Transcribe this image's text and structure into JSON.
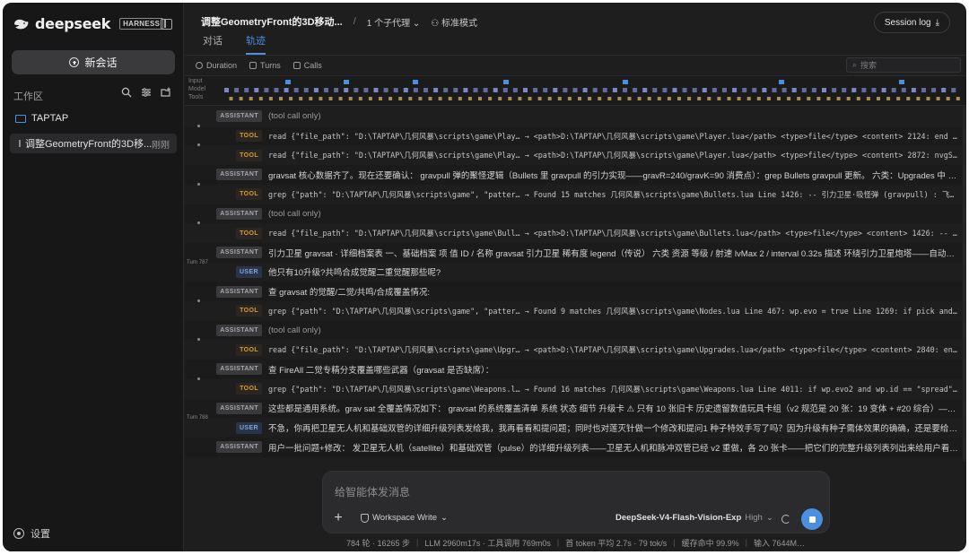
{
  "sidebar": {
    "brand": "deepseek",
    "badge": "HARNESS",
    "new_chat": "新会话",
    "workspace_label": "工作区",
    "folder": "TAPTAP",
    "session": {
      "title": "调整GeometryFront的3D移...",
      "time": "刚刚"
    },
    "settings": "设置"
  },
  "header": {
    "title": "调整GeometryFront的3D移动...",
    "separator": "/",
    "agents": "1 个子代理",
    "mode": "标准模式",
    "session_log": "Session log"
  },
  "tabs": [
    {
      "label": "对话"
    },
    {
      "label": "轨迹",
      "active": true
    }
  ],
  "toolbar": {
    "duration": "Duration",
    "turns": "Turns",
    "calls": "Calls",
    "search_placeholder": "搜索"
  },
  "timeline": {
    "labels": [
      "Input",
      "Model",
      "Tools"
    ]
  },
  "colors": {
    "accent": "#4a8fe0",
    "tool": "#d99b2e",
    "user": "#7ea6e0",
    "timeline_model": "#7e8fd0",
    "timeline_tool": "#c9a35a"
  },
  "transcript": [
    {
      "role": "ASSISTANT",
      "text": "(tool call only)",
      "muted": true
    },
    {
      "role": "TOOL",
      "text": "read {\"file_path\": \"D:\\TAPTAP\\几何风暴\\scripts\\game\\Play…  → <path>D:\\TAPTAP\\几何风暴\\scripts\\game\\Player.lua</path> <type>file</type> <content> 2124: end 2125: …",
      "mono": true
    },
    {
      "role": "TOOL",
      "text": "read {\"file_path\": \"D:\\TAPTAP\\几何风暴\\scripts\\game\\Play…  → <path>D:\\TAPTAP\\几何风暴\\scripts\\game\\Player.lua</path> <type>file</type> <content> 2872: nvgStroke(…",
      "mono": true
    },
    {
      "role": "ASSISTANT",
      "text": "gravsat 核心数据齐了。现在还要确认： gravpull 弹的聚怪逻辑（Bullets 里 gravpull 的引力实现——gravR=240/gravK=90 消费点）：grep Bullets gravpull 更新。 六类：Upgrades 中 gravsat 的 w_tag…"
    },
    {
      "role": "TOOL",
      "text": "grep {\"path\": \"D:\\TAPTAP\\几何风暴\\scripts\\game\", \"patter…  → Found 15 matches 几何风暴\\scripts\\game\\Bullets.lua Line 1426: -- 引力卫星·吸怪弹 (gravpull) : 飞行途中…",
      "mono": true
    },
    {
      "role": "ASSISTANT",
      "text": "(tool call only)",
      "muted": true
    },
    {
      "role": "TOOL",
      "text": "read {\"file_path\": \"D:\\TAPTAP\\几何风暴\\scripts\\game\\Bull…  → <path>D:\\TAPTAP\\几何风暴\\scripts\\game\\Bullets.lua</path> <type>file</type> <content> 1426: -- 引力卫…",
      "mono": true
    },
    {
      "role": "ASSISTANT",
      "text": "引力卫星 gravsat · 详细档案表 一、基础档案 项 值 ID / 名称 gravsat 引力卫星 稀有度 legend（传说） 六类 资源 等级 / 射速 lvMax 2 / interval 0.32s 描述 环绕引力卫星炮塔——自动发射吸怪弹（飞…"
    },
    {
      "role": "USER",
      "text": "他只有10升级?共鸣合成觉醒二重觉醒那些呢?",
      "turn": "Turn 787"
    },
    {
      "role": "ASSISTANT",
      "text": "查 gravsat 的觉醒/二觉/共鸣/合成覆盖情况:"
    },
    {
      "role": "TOOL",
      "text": "grep {\"path\": \"D:\\TAPTAP\\几何风暴\\scripts\\game\", \"patter…  → Found 9 matches 几何风暴\\scripts\\game\\Nodes.lua Line 467: wp.evo = true Line 1269: if pick and not p…",
      "mono": true
    },
    {
      "role": "ASSISTANT",
      "text": "(tool call only)",
      "muted": true
    },
    {
      "role": "TOOL",
      "text": "read {\"file_path\": \"D:\\TAPTAP\\几何风暴\\scripts\\game\\Upgr…  → <path>D:\\TAPTAP\\几何风暴\\scripts\\game\\Upgrades.lua</path> <type>file</type> <content> 2840: end 2841…",
      "mono": true
    },
    {
      "role": "ASSISTANT",
      "text": "查 FireAll 二觉专精分支覆盖哪些武器（gravsat 是否缺席）："
    },
    {
      "role": "TOOL",
      "text": "grep {\"path\": \"D:\\TAPTAP\\几何风暴\\scripts\\game\\Weapons.l…  → Found 16 matches 几何风暴\\scripts\\game\\Weapons.lua Line 4011: if wp.evo2 and wp.id == \"spread\" and b…",
      "mono": true
    },
    {
      "role": "ASSISTANT",
      "text": "这些都是通用系统。grav sat 全覆盖情况如下： gravsat 的系统覆盖清单 系统 状态 细节 升级卡 ⚠ 只有 10 张旧卡 历史遗留数值玩具卡组（v2 规范是 20 张：19 变体 + #20 综合）——重做时补齐 觉…"
    },
    {
      "role": "USER",
      "text": "不急，你再把卫星无人机和基础双管的详细升级列表发给我，我再看看和提问题；同时也对莲灭针做一个修改和提问1 种子特效手写了吗？因为升级有种子需体效果的确确，还是要给人看到的（不用大）…",
      "turn": "Turn 788"
    },
    {
      "role": "ASSISTANT",
      "text": "用户一批问题+修改： 发卫星无人机（satellite）和基础双管（pulse）的详细升级列表——卫星无人机和脉冲双管已经 v2 重做，各 20 张卡——把它们的完整升级列表列出来给用户看（详细数据列表，…"
    }
  ],
  "composer": {
    "placeholder": "给智能体发消息",
    "workspace": "Workspace Write",
    "model": "DeepSeek-V4-Flash-Vision-Exp",
    "level": "High"
  },
  "status": [
    "784 轮 · 16265 步",
    "LLM 2960m17s · 工具调用 769m0s",
    "首 token 平均 2.7s · 79 tok/s",
    "缓存命中 99.9%",
    "输入 7644M…"
  ]
}
